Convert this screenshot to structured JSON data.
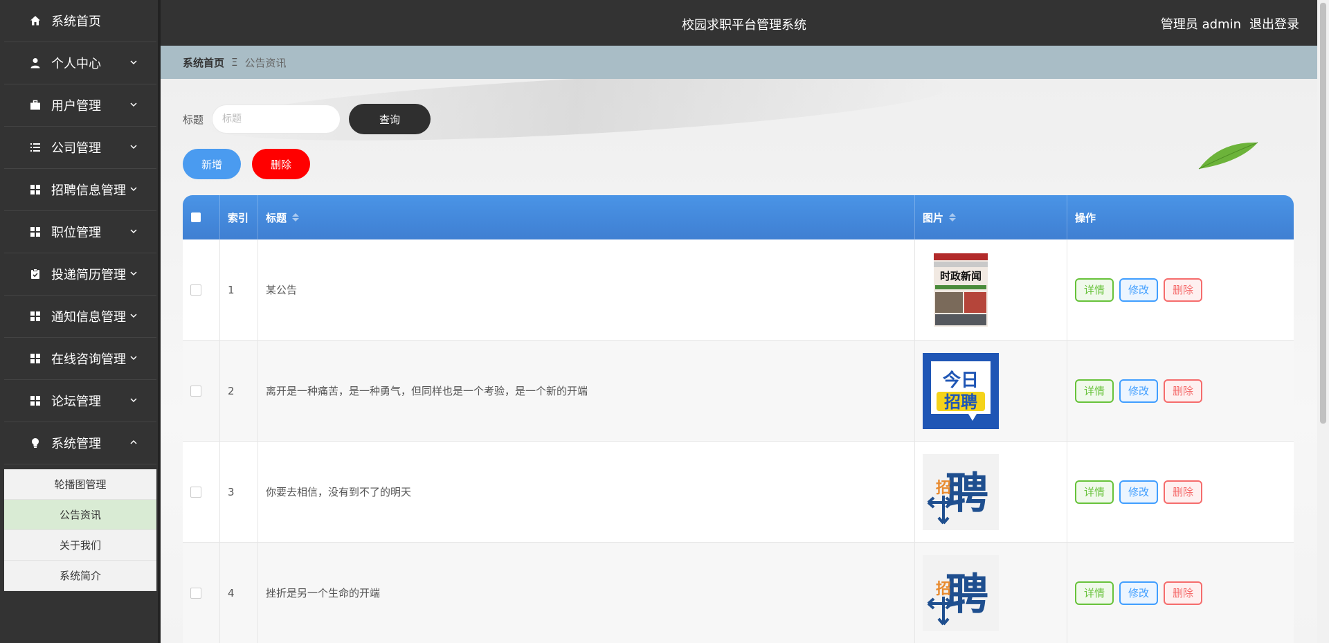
{
  "sidebar": {
    "items": [
      {
        "label": "系统首页",
        "icon": "home-icon",
        "has_chevron": false
      },
      {
        "label": "个人中心",
        "icon": "user-icon",
        "has_chevron": true
      },
      {
        "label": "用户管理",
        "icon": "briefcase-icon",
        "has_chevron": true
      },
      {
        "label": "公司管理",
        "icon": "list-icon",
        "has_chevron": true
      },
      {
        "label": "招聘信息管理",
        "icon": "grid-icon",
        "has_chevron": true
      },
      {
        "label": "职位管理",
        "icon": "grid-icon",
        "has_chevron": true
      },
      {
        "label": "投递简历管理",
        "icon": "clipboard-check-icon",
        "has_chevron": true
      },
      {
        "label": "通知信息管理",
        "icon": "grid-icon",
        "has_chevron": true
      },
      {
        "label": "在线咨询管理",
        "icon": "grid-icon",
        "has_chevron": true
      },
      {
        "label": "论坛管理",
        "icon": "grid-icon",
        "has_chevron": true
      },
      {
        "label": "系统管理",
        "icon": "lightbulb-icon",
        "has_chevron": true,
        "expanded": true
      }
    ],
    "submenu": [
      {
        "label": "轮播图管理",
        "active": false
      },
      {
        "label": "公告资讯",
        "active": true
      },
      {
        "label": "关于我们",
        "active": false
      },
      {
        "label": "系统简介",
        "active": false
      }
    ]
  },
  "header": {
    "title": "校园求职平台管理系统",
    "user": "管理员 admin",
    "logout": "退出登录"
  },
  "breadcrumb": {
    "home": "系统首页",
    "separator": "Ξ",
    "current": "公告资讯"
  },
  "search": {
    "label": "标题",
    "placeholder": "标题",
    "value": "",
    "button": "查询"
  },
  "actions": {
    "add": "新增",
    "delete": "删除"
  },
  "table": {
    "columns": {
      "index": "索引",
      "title": "标题",
      "image": "图片",
      "ops": "操作"
    },
    "rows": [
      {
        "index": "1",
        "title": "某公告",
        "image": "news-magazine-cover"
      },
      {
        "index": "2",
        "title": "离开是一种痛苦，是一种勇气，但同样也是一个考验，是一个新的开端",
        "image": "today-hiring-poster"
      },
      {
        "index": "3",
        "title": "你要去相信，没有到不了的明天",
        "image": "hiring-arrows-logo"
      },
      {
        "index": "4",
        "title": "挫折是另一个生命的开端",
        "image": "hiring-arrows-logo"
      }
    ],
    "op_labels": {
      "detail": "详情",
      "edit": "修改",
      "delete": "删除"
    }
  },
  "thumb_text": {
    "news_headline": "时政新闻",
    "today_line1": "今日",
    "today_line2": "招聘",
    "hire_small": "招",
    "hire_big": "聘"
  },
  "colors": {
    "sidebar_bg": "#333333",
    "header_bg": "#333333",
    "breadcrumb_bg": "#a9bdc6",
    "table_header": "#4a94e6",
    "add_button": "#4a9bf0",
    "delete_button": "#ff0000",
    "active_submenu": "#d9ebd4"
  }
}
